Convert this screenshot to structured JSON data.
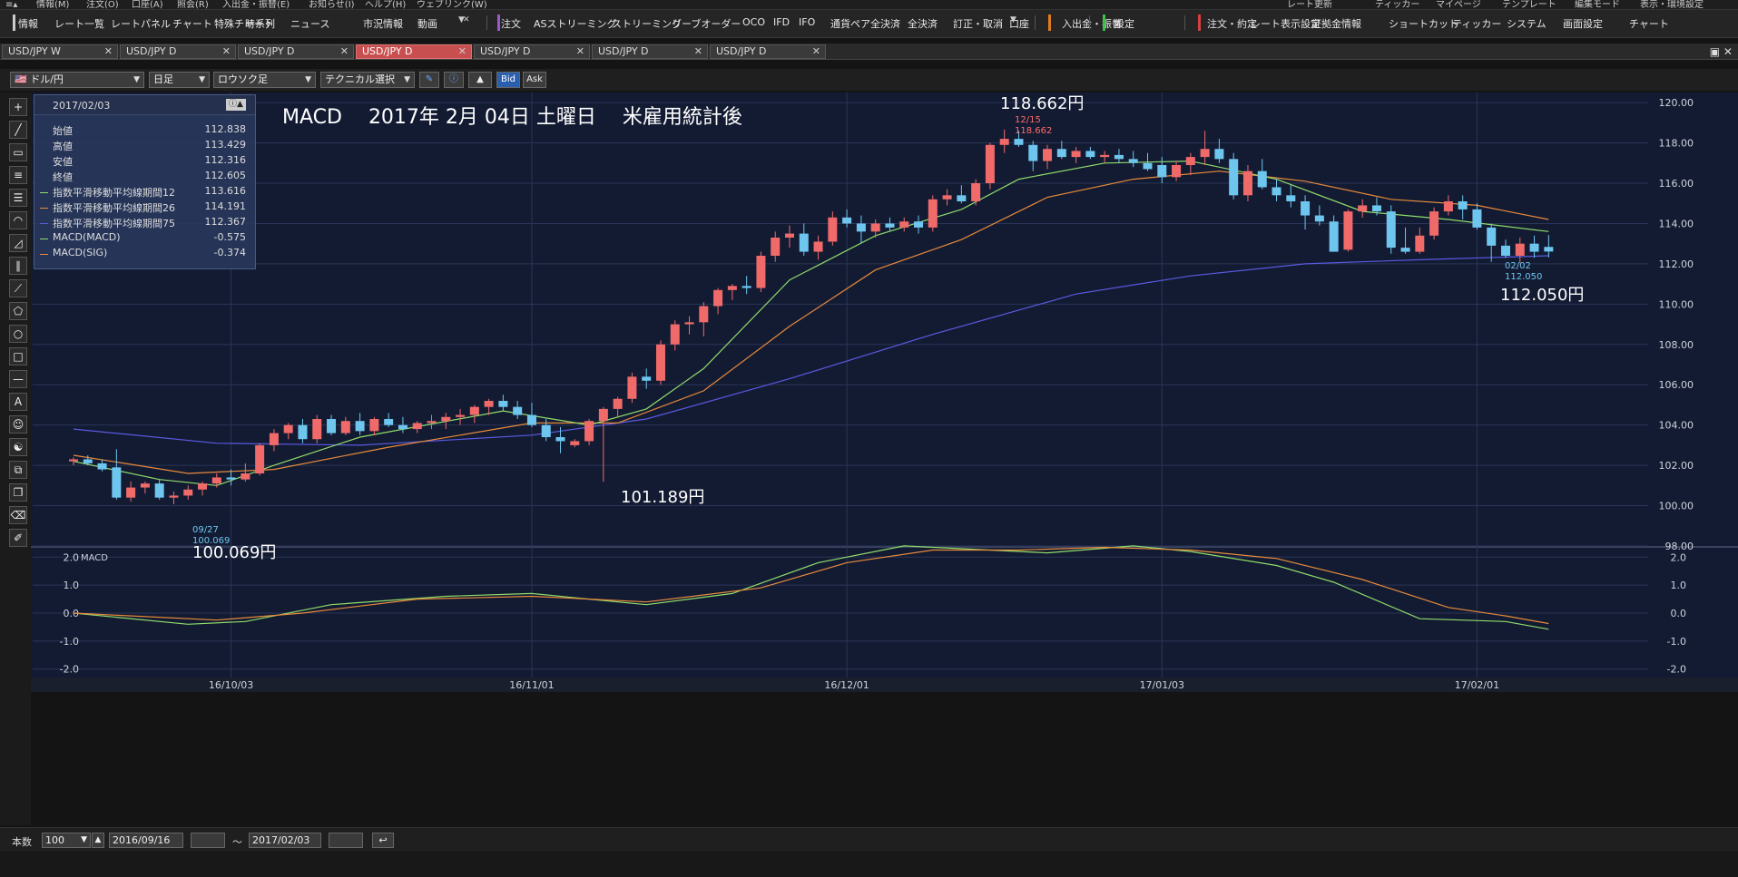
{
  "menubar": {
    "items": [
      "情報(M)",
      "注文(O)",
      "口座(A)",
      "照会(R)",
      "入出金・振替(E)",
      "お知らせ(I)",
      "ヘルプ(H)",
      "ウェブリンク(W)"
    ],
    "right_items": [
      "レート更新",
      "ティッカー",
      "マイページ",
      "テンプレート",
      "編集モード",
      "表示・環境設定"
    ]
  },
  "toolbar": {
    "items": [
      "情報",
      "レート一覧",
      "レートパネル",
      "チャート",
      "特殊チャート",
      "時系列",
      "ニュース",
      "市況情報",
      "動画",
      "注文",
      "ASストリーミング",
      "ストリーミング",
      "リーブオーダー",
      "OCO",
      "IFD",
      "IFO",
      "通貨ペア全決済",
      "全決済",
      "訂正・取消",
      "口座",
      "入出金・振替",
      "設定",
      "注文・約定",
      "レート表示設定",
      "証拠金情報",
      "ショートカット",
      "ティッカー",
      "システム",
      "画面設定",
      "チャート"
    ]
  },
  "tabs": [
    {
      "label": "USD/JPY W",
      "active": false
    },
    {
      "label": "USD/JPY D",
      "active": false
    },
    {
      "label": "USD/JPY D",
      "active": false
    },
    {
      "label": "USD/JPY D",
      "active": true
    },
    {
      "label": "USD/JPY D",
      "active": false
    },
    {
      "label": "USD/JPY D",
      "active": false
    },
    {
      "label": "USD/JPY D",
      "active": false
    }
  ],
  "chart_toolbar": {
    "pair": "ドル/円",
    "period": "日足",
    "style": "ロウソク足",
    "technical": "テクニカル選択",
    "bid": "Bid",
    "ask": "Ask"
  },
  "ohlc_panel": {
    "date": "2017/02/03",
    "rows": [
      {
        "label": "始値",
        "value": "112.838",
        "color": ""
      },
      {
        "label": "高値",
        "value": "113.429",
        "color": ""
      },
      {
        "label": "安値",
        "value": "112.316",
        "color": ""
      },
      {
        "label": "終値",
        "value": "112.605",
        "color": ""
      },
      {
        "label": "指数平滑移動平均線期間12",
        "value": "113.616",
        "color": "#8fdc6a"
      },
      {
        "label": "指数平滑移動平均線期間26",
        "value": "114.191",
        "color": "#e88a3a"
      },
      {
        "label": "指数平滑移動平均線期間75",
        "value": "112.367",
        "color": "#5a5ae0"
      },
      {
        "label": "MACD(MACD)",
        "value": "-0.575",
        "color": "#8fdc6a"
      },
      {
        "label": "MACD(SIG)",
        "value": "-0.374",
        "color": "#e88a3a"
      }
    ]
  },
  "annotations": {
    "title": "MACD　 2017年 2月 04日 土曜日　 米雇用統計後",
    "high_label": "118.662円",
    "high_date": "12/15",
    "high_value": "118.662",
    "low_label": "100.069円",
    "low_date": "09/27",
    "low_value": "100.069",
    "mid_low_label": "101.189円",
    "last_label": "112.050円",
    "last_date": "02/02",
    "last_value": "112.050"
  },
  "chart_data": [
    {
      "type": "candlestick",
      "colors": {
        "up": "#f06a6a",
        "down": "#6ec6ef",
        "ema12": "#8fdc6a",
        "ema26": "#e88a3a",
        "ema75": "#5a5ae0"
      },
      "ylim": [
        98,
        120.5
      ],
      "y_ticks": [
        "98.00",
        "100.00",
        "102.00",
        "104.00",
        "106.00",
        "108.00",
        "110.00",
        "112.00",
        "114.00",
        "116.00",
        "118.00",
        "120.00"
      ],
      "x_labels": [
        {
          "label": "16/10/03",
          "index": 11
        },
        {
          "label": "16/11/01",
          "index": 32
        },
        {
          "label": "16/12/01",
          "index": 54
        },
        {
          "label": "17/01/03",
          "index": 76
        },
        {
          "label": "17/02/01",
          "index": 98
        }
      ],
      "ohlc": [
        [
          102.2,
          102.4,
          102.0,
          102.3
        ],
        [
          102.3,
          102.5,
          102.0,
          102.1
        ],
        [
          102.1,
          102.3,
          101.7,
          101.8
        ],
        [
          101.9,
          102.8,
          100.3,
          100.4
        ],
        [
          100.4,
          101.2,
          100.2,
          100.9
        ],
        [
          100.9,
          101.2,
          100.6,
          101.1
        ],
        [
          101.1,
          101.3,
          100.3,
          100.4
        ],
        [
          100.4,
          100.7,
          100.07,
          100.5
        ],
        [
          100.5,
          101.0,
          100.3,
          100.8
        ],
        [
          100.8,
          101.2,
          100.5,
          101.1
        ],
        [
          101.1,
          101.6,
          100.9,
          101.4
        ],
        [
          101.4,
          101.8,
          101.0,
          101.3
        ],
        [
          101.3,
          102.1,
          101.2,
          101.6
        ],
        [
          101.6,
          103.1,
          101.5,
          103.0
        ],
        [
          103.0,
          103.8,
          102.7,
          103.6
        ],
        [
          103.6,
          104.1,
          103.3,
          104.0
        ],
        [
          104.0,
          104.3,
          103.1,
          103.3
        ],
        [
          103.3,
          104.5,
          103.1,
          104.3
        ],
        [
          104.3,
          104.5,
          103.5,
          103.6
        ],
        [
          103.6,
          104.4,
          103.5,
          104.2
        ],
        [
          104.2,
          104.6,
          103.5,
          103.7
        ],
        [
          103.7,
          104.4,
          103.5,
          104.3
        ],
        [
          104.3,
          104.6,
          103.9,
          104.0
        ],
        [
          104.0,
          104.4,
          103.6,
          103.8
        ],
        [
          103.8,
          104.2,
          103.6,
          104.1
        ],
        [
          104.1,
          104.5,
          103.8,
          104.2
        ],
        [
          104.2,
          104.6,
          103.8,
          104.4
        ],
        [
          104.4,
          104.8,
          104.0,
          104.5
        ],
        [
          104.5,
          105.0,
          104.1,
          104.9
        ],
        [
          104.9,
          105.3,
          104.5,
          105.2
        ],
        [
          105.2,
          105.5,
          104.7,
          104.9
        ],
        [
          104.9,
          105.2,
          104.3,
          104.5
        ],
        [
          104.5,
          105.1,
          103.9,
          104.0
        ],
        [
          104.0,
          104.3,
          103.2,
          103.4
        ],
        [
          103.4,
          103.9,
          102.6,
          103.2
        ],
        [
          103.0,
          103.3,
          102.9,
          103.2
        ],
        [
          103.2,
          104.3,
          103.0,
          104.2
        ],
        [
          104.2,
          104.9,
          101.19,
          104.8
        ],
        [
          104.8,
          105.4,
          104.4,
          105.3
        ],
        [
          105.3,
          106.6,
          105.1,
          106.4
        ],
        [
          106.4,
          106.8,
          105.8,
          106.2
        ],
        [
          106.2,
          108.2,
          106.0,
          108.0
        ],
        [
          108.0,
          109.2,
          107.7,
          109.0
        ],
        [
          109.0,
          109.4,
          108.5,
          109.1
        ],
        [
          109.1,
          110.1,
          108.4,
          109.9
        ],
        [
          109.9,
          110.8,
          109.5,
          110.7
        ],
        [
          110.7,
          111.0,
          110.2,
          110.9
        ],
        [
          110.9,
          111.4,
          110.5,
          110.8
        ],
        [
          110.8,
          112.6,
          110.6,
          112.4
        ],
        [
          112.4,
          113.6,
          112.1,
          113.3
        ],
        [
          113.3,
          113.9,
          112.8,
          113.5
        ],
        [
          113.5,
          114.0,
          112.4,
          112.6
        ],
        [
          112.6,
          113.4,
          112.2,
          113.1
        ],
        [
          113.1,
          114.6,
          112.9,
          114.3
        ],
        [
          114.3,
          114.7,
          113.8,
          114.0
        ],
        [
          114.0,
          114.4,
          113.0,
          113.6
        ],
        [
          113.6,
          114.2,
          113.3,
          114.0
        ],
        [
          114.0,
          114.3,
          113.6,
          113.8
        ],
        [
          113.8,
          114.3,
          113.6,
          114.1
        ],
        [
          114.1,
          114.4,
          113.5,
          113.8
        ],
        [
          113.8,
          115.4,
          113.6,
          115.2
        ],
        [
          115.2,
          115.7,
          114.9,
          115.4
        ],
        [
          115.4,
          115.9,
          115.0,
          115.1
        ],
        [
          115.1,
          116.2,
          114.9,
          116.0
        ],
        [
          116.0,
          118.0,
          115.7,
          117.9
        ],
        [
          117.9,
          118.66,
          117.5,
          118.2
        ],
        [
          118.2,
          118.6,
          117.8,
          117.9
        ],
        [
          117.9,
          118.1,
          116.6,
          117.1
        ],
        [
          117.1,
          117.9,
          116.7,
          117.7
        ],
        [
          117.7,
          118.1,
          117.2,
          117.3
        ],
        [
          117.3,
          117.8,
          117.0,
          117.6
        ],
        [
          117.6,
          117.8,
          117.2,
          117.3
        ],
        [
          117.3,
          117.6,
          117.0,
          117.4
        ],
        [
          117.4,
          117.7,
          117.0,
          117.2
        ],
        [
          117.2,
          117.6,
          116.8,
          117.0
        ],
        [
          117.0,
          117.5,
          116.6,
          116.7
        ],
        [
          116.9,
          117.3,
          116.0,
          116.3
        ],
        [
          116.3,
          117.1,
          116.1,
          116.9
        ],
        [
          116.9,
          117.5,
          116.4,
          117.3
        ],
        [
          117.3,
          118.6,
          116.9,
          117.7
        ],
        [
          117.7,
          118.2,
          117.0,
          117.2
        ],
        [
          117.2,
          117.5,
          115.2,
          115.4
        ],
        [
          115.4,
          116.9,
          115.1,
          116.6
        ],
        [
          116.6,
          117.2,
          115.7,
          115.8
        ],
        [
          115.8,
          116.2,
          115.1,
          115.4
        ],
        [
          115.4,
          115.9,
          114.8,
          115.1
        ],
        [
          115.1,
          115.4,
          113.7,
          114.4
        ],
        [
          114.4,
          114.9,
          113.9,
          114.1
        ],
        [
          114.1,
          114.4,
          112.6,
          112.6
        ],
        [
          112.7,
          114.7,
          112.6,
          114.6
        ],
        [
          114.6,
          115.2,
          114.3,
          114.9
        ],
        [
          114.9,
          115.3,
          114.4,
          114.6
        ],
        [
          114.6,
          114.9,
          112.5,
          112.8
        ],
        [
          112.8,
          113.8,
          112.5,
          112.6
        ],
        [
          112.6,
          113.8,
          112.5,
          113.4
        ],
        [
          113.4,
          114.8,
          113.2,
          114.6
        ],
        [
          114.6,
          115.4,
          114.4,
          115.1
        ],
        [
          115.1,
          115.4,
          114.2,
          114.7
        ],
        [
          114.7,
          115.0,
          113.7,
          113.8
        ],
        [
          113.8,
          114.0,
          112.1,
          112.9
        ],
        [
          112.9,
          113.2,
          112.3,
          112.4
        ],
        [
          112.4,
          113.3,
          112.05,
          113.0
        ],
        [
          113.0,
          113.4,
          112.3,
          112.6
        ],
        [
          112.84,
          113.43,
          112.32,
          112.61
        ]
      ],
      "ema12_points": [
        [
          0,
          102.2
        ],
        [
          6,
          101.3
        ],
        [
          10,
          101.0
        ],
        [
          14,
          102.0
        ],
        [
          20,
          103.4
        ],
        [
          30,
          104.7
        ],
        [
          36,
          104.0
        ],
        [
          40,
          104.8
        ],
        [
          44,
          106.8
        ],
        [
          50,
          111.2
        ],
        [
          56,
          113.4
        ],
        [
          62,
          114.7
        ],
        [
          66,
          116.2
        ],
        [
          72,
          117.0
        ],
        [
          78,
          117.1
        ],
        [
          84,
          116.2
        ],
        [
          90,
          114.6
        ],
        [
          96,
          114.2
        ],
        [
          103,
          113.6
        ]
      ],
      "ema26_points": [
        [
          0,
          102.5
        ],
        [
          8,
          101.6
        ],
        [
          14,
          101.8
        ],
        [
          22,
          102.9
        ],
        [
          32,
          104.1
        ],
        [
          38,
          104.1
        ],
        [
          44,
          105.7
        ],
        [
          50,
          108.9
        ],
        [
          56,
          111.7
        ],
        [
          62,
          113.2
        ],
        [
          68,
          115.3
        ],
        [
          74,
          116.2
        ],
        [
          80,
          116.6
        ],
        [
          86,
          116.1
        ],
        [
          92,
          115.2
        ],
        [
          98,
          114.9
        ],
        [
          103,
          114.2
        ]
      ],
      "ema75_points": [
        [
          0,
          103.8
        ],
        [
          10,
          103.1
        ],
        [
          20,
          103.0
        ],
        [
          32,
          103.5
        ],
        [
          40,
          104.3
        ],
        [
          50,
          106.3
        ],
        [
          60,
          108.5
        ],
        [
          70,
          110.5
        ],
        [
          78,
          111.4
        ],
        [
          86,
          112.0
        ],
        [
          94,
          112.2
        ],
        [
          103,
          112.4
        ]
      ]
    },
    {
      "type": "line",
      "title": "MACD",
      "ylim": [
        -2.3,
        2.3
      ],
      "y_ticks": [
        "2.0",
        "1.0",
        "0.0",
        "-1.0",
        "-2.0"
      ],
      "series": [
        {
          "color": "#8fdc6a",
          "points": [
            [
              0,
              0.0
            ],
            [
              8,
              -0.4
            ],
            [
              12,
              -0.3
            ],
            [
              18,
              0.3
            ],
            [
              26,
              0.6
            ],
            [
              32,
              0.7
            ],
            [
              36,
              0.5
            ],
            [
              40,
              0.3
            ],
            [
              46,
              0.7
            ],
            [
              52,
              1.8
            ],
            [
              58,
              2.4
            ],
            [
              62,
              2.3
            ],
            [
              68,
              2.15
            ],
            [
              74,
              2.4
            ],
            [
              78,
              2.2
            ],
            [
              84,
              1.7
            ],
            [
              88,
              1.1
            ],
            [
              94,
              -0.2
            ],
            [
              100,
              -0.3
            ],
            [
              103,
              -0.575
            ]
          ]
        },
        {
          "color": "#e88a3a",
          "points": [
            [
              0,
              0.0
            ],
            [
              10,
              -0.25
            ],
            [
              16,
              0.0
            ],
            [
              24,
              0.5
            ],
            [
              32,
              0.6
            ],
            [
              40,
              0.4
            ],
            [
              48,
              0.9
            ],
            [
              54,
              1.8
            ],
            [
              60,
              2.25
            ],
            [
              66,
              2.25
            ],
            [
              72,
              2.35
            ],
            [
              78,
              2.25
            ],
            [
              84,
              1.95
            ],
            [
              90,
              1.2
            ],
            [
              96,
              0.2
            ],
            [
              100,
              -0.1
            ],
            [
              103,
              -0.374
            ]
          ]
        }
      ]
    }
  ],
  "status": {
    "count_label": "本数",
    "count_value": "100",
    "from_date": "2016/09/16",
    "tilde": "～",
    "to_date": "2017/02/03"
  }
}
